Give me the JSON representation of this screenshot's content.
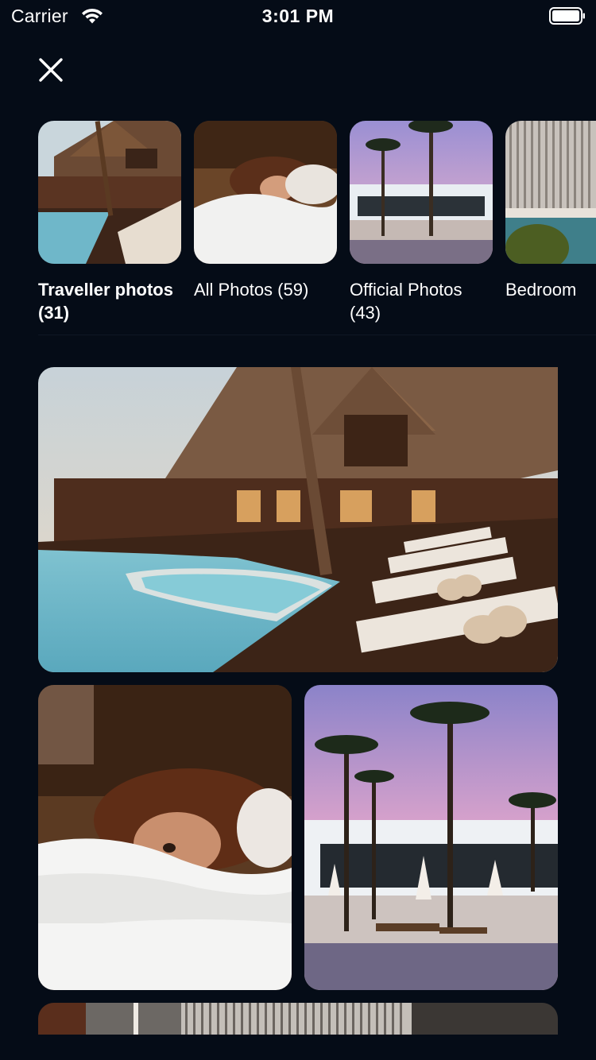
{
  "status_bar": {
    "carrier": "Carrier",
    "time": "3:01 PM",
    "icons": [
      "wifi-icon",
      "battery-icon"
    ]
  },
  "header": {
    "close_icon": "close-icon"
  },
  "albums": [
    {
      "title": "Traveller photos\n(31)",
      "selected": true
    },
    {
      "title": "All Photos (59)",
      "selected": false
    },
    {
      "title": "Official Photos\n(43)",
      "selected": false
    },
    {
      "title": "Bedroom",
      "selected": false
    }
  ],
  "photos": [
    {
      "subject": "resort-pool-deck"
    },
    {
      "subject": "woman-in-bed"
    },
    {
      "subject": "palm-trees-sunset-pool"
    },
    {
      "subject": "striped-interior"
    }
  ],
  "colors": {
    "background": "#050c17",
    "text": "#ffffff"
  }
}
